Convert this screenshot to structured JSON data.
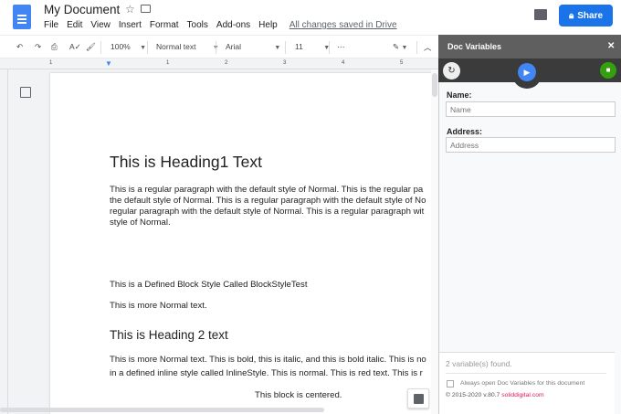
{
  "header": {
    "title": "My Document",
    "menu": [
      "File",
      "Edit",
      "View",
      "Insert",
      "Format",
      "Tools",
      "Add-ons",
      "Help"
    ],
    "saved_status": "All changes saved in Drive",
    "share_label": "Share",
    "accent": "#1a73e8"
  },
  "toolbar": {
    "zoom": "100%",
    "style": "Normal text",
    "font": "Arial",
    "size": "11",
    "more": "⋯"
  },
  "ruler": {
    "marks": [
      "1",
      "1",
      "2",
      "3",
      "4",
      "5"
    ]
  },
  "document": {
    "heading1": "This is Heading1 Text",
    "para1": [
      "This is a regular paragraph with the default style of Normal. This is the regular pa",
      "the default style of Normal. This is a regular paragraph with the default style of No",
      "regular paragraph with the default style of Normal. This is a regular paragraph wit",
      "style of Normal."
    ],
    "block_style": "This is a Defined Block Style Called BlockStyleTest",
    "more_normal": "This is more Normal text.",
    "heading2": "This is Heading 2 text",
    "para2": [
      "This is more Normal text. This is bold, this is italic, and this is bold italic. This is no",
      "in a defined inline style called InlineStyle. This is normal. This is red text. This is r"
    ],
    "centered": "This block is centered."
  },
  "panel": {
    "title": "Doc Variables",
    "close": "✕",
    "fields": [
      {
        "label": "Name:",
        "placeholder": "Name"
      },
      {
        "label": "Address:",
        "placeholder": "Address"
      }
    ],
    "found": "2 variable(s) found.",
    "checkbox_label": "Always open Doc Variables for this document",
    "copyright": "© 2015-2020 v.80.7",
    "link": "soliddigital.com",
    "link_color": "#d81b60"
  }
}
